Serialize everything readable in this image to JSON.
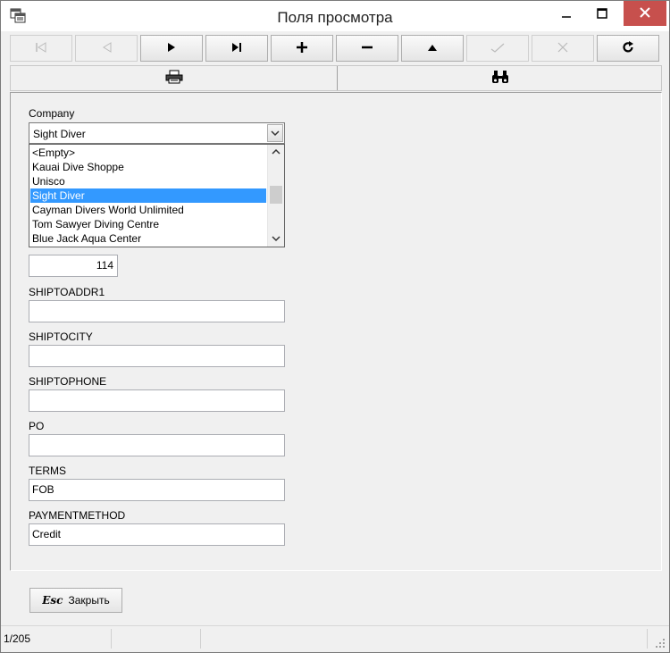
{
  "window": {
    "title": "Поля просмотра"
  },
  "toolbar": {
    "buttons": [
      {
        "name": "first-record-button",
        "enabled": false
      },
      {
        "name": "prior-record-button",
        "enabled": false
      },
      {
        "name": "next-record-button",
        "enabled": true
      },
      {
        "name": "last-record-button",
        "enabled": true
      },
      {
        "name": "insert-record-button",
        "enabled": true
      },
      {
        "name": "delete-record-button",
        "enabled": true
      },
      {
        "name": "edit-record-button",
        "enabled": true
      },
      {
        "name": "post-record-button",
        "enabled": false
      },
      {
        "name": "cancel-record-button",
        "enabled": false
      },
      {
        "name": "refresh-button",
        "enabled": true
      }
    ]
  },
  "tabs": [
    {
      "icon": "printer-icon"
    },
    {
      "icon": "binoculars-icon"
    }
  ],
  "form": {
    "company_label": "Company",
    "company_value": "Sight Diver",
    "company_options": [
      "<Empty>",
      "Kauai Dive Shoppe",
      "Unisco",
      "Sight Diver",
      "Cayman Divers World Unlimited",
      "Tom Sawyer Diving Centre",
      "Blue Jack Aqua Center"
    ],
    "company_selected_index": 3,
    "empno_value": "114",
    "shiptoaddr1_label": "SHIPTOADDR1",
    "shiptoaddr1_value": "",
    "shiptocity_label": "SHIPTOCITY",
    "shiptocity_value": "",
    "shiptophone_label": "SHIPTOPHONE",
    "shiptophone_value": "",
    "po_label": "PO",
    "po_value": "",
    "terms_label": "TERMS",
    "terms_value": "FOB",
    "paymentmethod_label": "PAYMENTMETHOD",
    "paymentmethod_value": "Credit"
  },
  "footer": {
    "close_shortcut": "Esc",
    "close_label": "Закрыть"
  },
  "statusbar": {
    "record_position": "1/205"
  },
  "colors": {
    "selection": "#3399ff",
    "close_button": "#c7504d"
  }
}
